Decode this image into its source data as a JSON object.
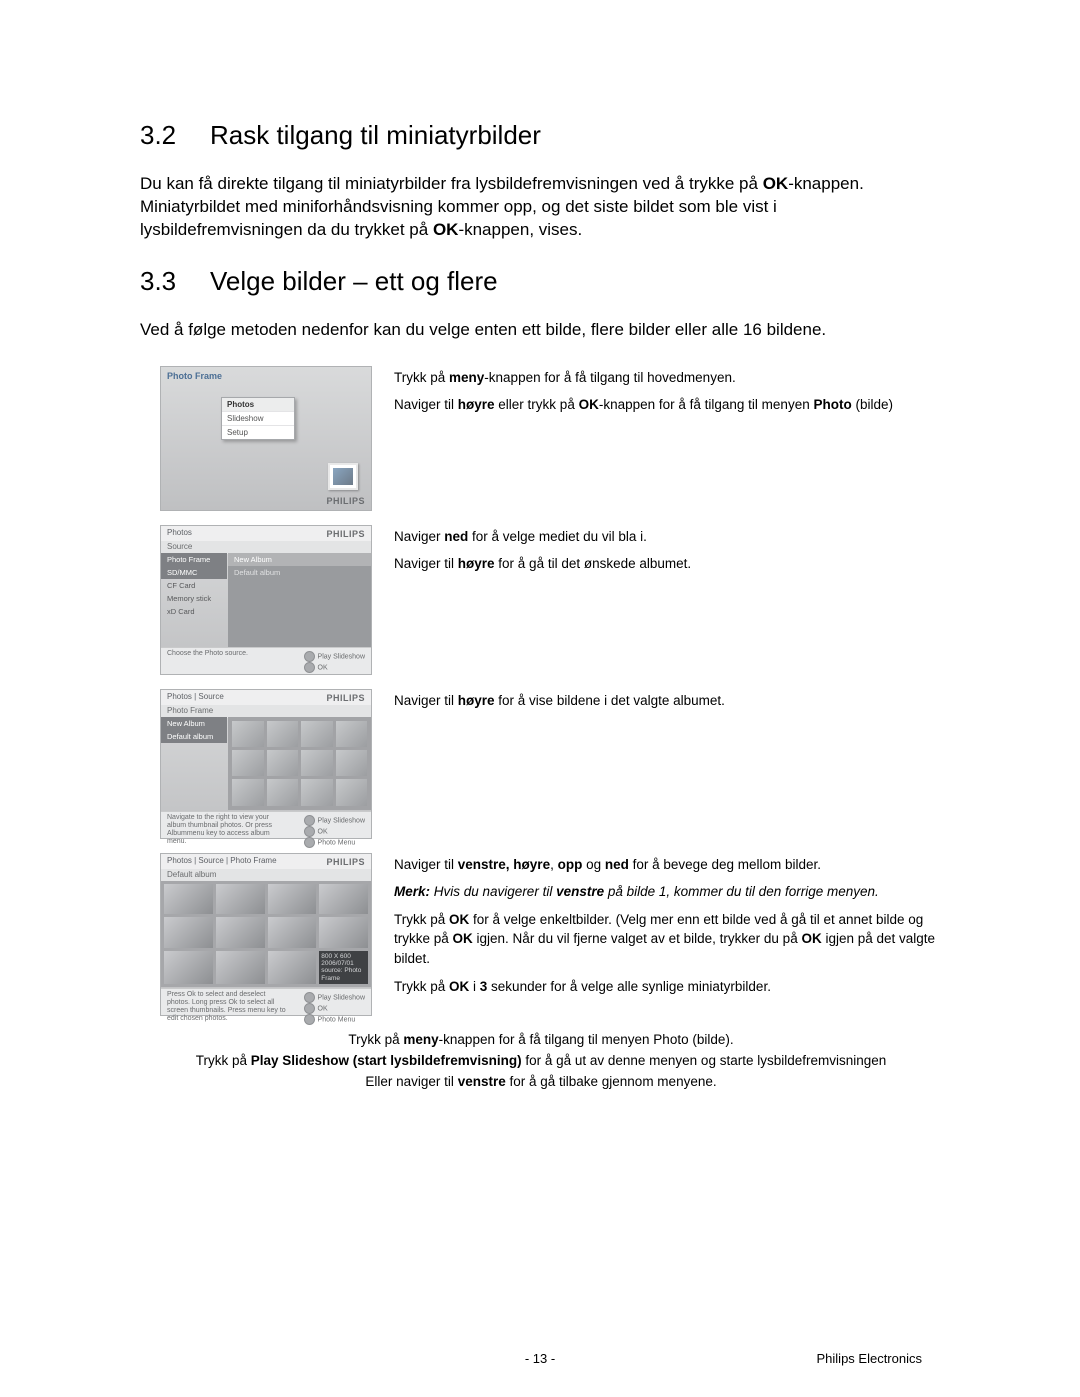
{
  "section32": {
    "num": "3.2",
    "title": "Rask tilgang til miniatyrbilder"
  },
  "p32": {
    "t1a": "Du kan få direkte tilgang til miniatyrbilder fra lysbildefremvisningen ved å trykke på ",
    "t1b": "OK",
    "t1c": "-knappen. Miniatyrbildet med miniforhåndsvisning kommer opp, og det siste bildet som ble vist i lysbildefremvisningen da du trykket på ",
    "t1d": "OK",
    "t1e": "-knappen, vises."
  },
  "section33": {
    "num": "3.3",
    "title": "Velge bilder – ett og flere"
  },
  "p33": "Ved å følge metoden nedenfor kan du velge enten ett bilde, flere bilder eller alle 16 bildene.",
  "step1": {
    "l1a": "Trykk på ",
    "l1b": "meny",
    "l1c": "-knappen for å få tilgang til hovedmenyen.",
    "l2a": "Naviger til ",
    "l2b": "høyre",
    "l2c": " eller trykk på ",
    "l2d": "OK",
    "l2e": "-knappen for å få tilgang til menyen ",
    "l2f": "Photo",
    "l2g": " (bilde)"
  },
  "step2": {
    "l1a": "Naviger ",
    "l1b": "ned",
    "l1c": " for å velge mediet du vil bla i.",
    "l2a": "Naviger til ",
    "l2b": "høyre",
    "l2c": " for å gå til det ønskede albumet."
  },
  "step3": {
    "l1a": "Naviger til ",
    "l1b": "høyre",
    "l1c": " for å vise bildene i det valgte albumet."
  },
  "step4": {
    "l1a": "Naviger til ",
    "l1b": "venstre, høyre",
    "l1c": ", ",
    "l1d": "opp",
    "l1e": " og ",
    "l1f": "ned",
    "l1g": " for å bevege deg mellom bilder.",
    "noteA": "Merk: ",
    "noteB": "Hvis du navigerer til ",
    "noteC": "venstre",
    "noteD": " på bilde 1, kommer du til den forrige menyen.",
    "l3a": "Trykk på ",
    "l3b": "OK",
    "l3c": " for å velge enkeltbilder. (Velg mer enn ett bilde ved å gå til et annet bilde og trykke på ",
    "l3d": "OK",
    "l3e": " igjen. Når du vil fjerne valget av et bilde, trykker du på ",
    "l3f": "OK",
    "l3g": " igjen på det valgte bildet.",
    "l4a": "Trykk på ",
    "l4b": "OK",
    "l4c": " i ",
    "l4d": "3",
    "l4e": " sekunder for å velge alle synlige miniatyrbilder."
  },
  "bottom": {
    "b1a": "Trykk på ",
    "b1b": "meny",
    "b1c": "-knappen for å få tilgang til menyen Photo (bilde).",
    "b2a": "Trykk på ",
    "b2b": "Play Slideshow (start lysbildefremvisning)",
    "b2c": " for å gå ut av denne menyen og starte lysbildefremvisningen",
    "b3a": "Eller naviger til ",
    "b3b": "venstre",
    "b3c": " for å gå tilbake gjennom menyene."
  },
  "footer": {
    "page": "- 13 -",
    "company": "Philips Electronics"
  },
  "shot": {
    "brand": "PHILIPS",
    "s1": {
      "title": "Photo Frame",
      "m1": "Photos",
      "m2": "Slideshow",
      "m3": "Setup"
    },
    "s2": {
      "hdr": "Photos",
      "sub": "Source",
      "c1": "Photo Frame",
      "c2": "SD/MMC",
      "c3": "CF Card",
      "c4": "Memory stick",
      "c5": "xD Card",
      "r1": "New Album",
      "r2": "Default album",
      "ft": "Choose  the Photo source.",
      "fa1": "Play Slideshow",
      "fa2": "OK"
    },
    "s3": {
      "hdr": "Photos | Source",
      "sub": "Photo Frame",
      "c1": "New Album",
      "c2": "Default album",
      "ft": "Navigate to the right to view your album thumbnail photos. Or press Albummenu key to access album menu.",
      "fa1": "Play Slideshow",
      "fa2": "OK",
      "fa3": "Photo Menu"
    },
    "s4": {
      "hdr": "Photos | Source | Photo Frame",
      "sub": "Default album",
      "cap": "800 X 600\n2006/07/01\nsource: Photo Frame",
      "ft": "Press Ok to select and deselect photos. Long press Ok to select all screen thumbnails. Press menu key to edit chosen photos.",
      "fa1": "Play Slideshow",
      "fa2": "OK",
      "fa3": "Photo Menu"
    }
  }
}
